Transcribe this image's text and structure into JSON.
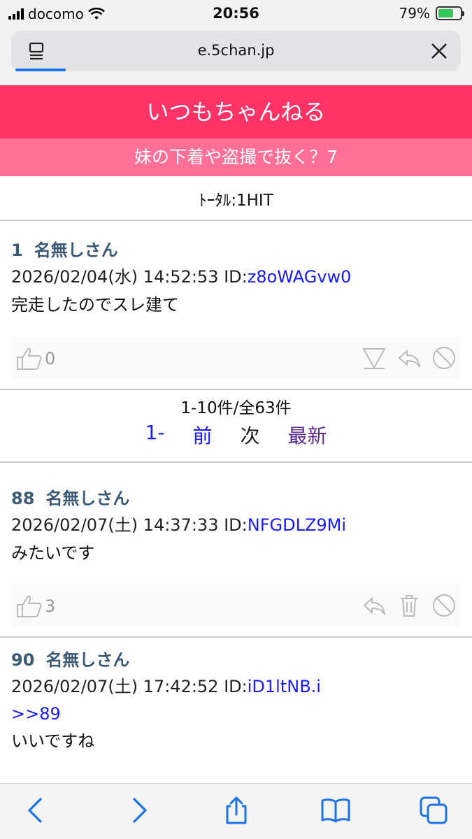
{
  "status": {
    "carrier": "docomo",
    "time": "20:56",
    "battery": "79%",
    "battery_level": 0.79
  },
  "browser": {
    "url": "e.5chan.jp",
    "icons": {
      "reader": "reader-icon",
      "close": "close-icon"
    }
  },
  "site": {
    "title": "いつもちゃんねる",
    "thread_title": "妹の下着や盗撮で抜く？7",
    "total": "ﾄｰﾀﾙ:1HIT"
  },
  "colors": {
    "header_bg": "#ff3366",
    "subheader_bg": "#ff6f96",
    "name_color": "#3d5a75",
    "link_color": "#1a1aff",
    "latest_color": "#5b2d8e"
  },
  "posts": [
    {
      "number": "1",
      "name": "名無しさん",
      "datetime": "2026/02/04(水) 14:52:53 ID:",
      "id": "z8oWAGvw0",
      "anchor": "",
      "body": "完走したのでスレ建て",
      "likes": "0"
    },
    {
      "number": "88",
      "name": "名無しさん",
      "datetime": "2026/02/07(土) 14:37:33 ID:",
      "id": "NFGDLZ9Mi",
      "anchor": "",
      "body": "みたいです",
      "likes": "3"
    },
    {
      "number": "90",
      "name": "名無しさん",
      "datetime": "2026/02/07(土) 17:42:52 ID:",
      "id": "iD1ltNB.i",
      "anchor": ">>89",
      "body": "いいですね",
      "likes": ""
    }
  ],
  "pager": {
    "count": "1-10件/全63件",
    "first": "1-",
    "prev": "前",
    "next": "次",
    "latest": "最新"
  },
  "toolbar": {
    "back": "back-chevron-icon",
    "forward": "forward-chevron-icon",
    "share": "share-icon",
    "bookmarks": "book-icon",
    "tabs": "tabs-icon"
  }
}
